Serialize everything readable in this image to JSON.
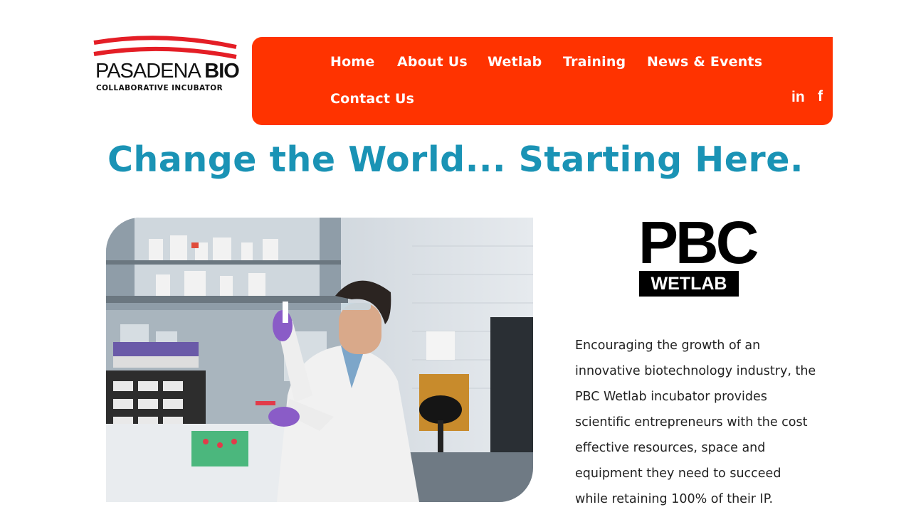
{
  "logo": {
    "name_regular": "PASADENA",
    "name_bold": "BIO",
    "tagline": "COLLABORATIVE INCUBATOR"
  },
  "nav": {
    "items": [
      {
        "label": "Home"
      },
      {
        "label": "About Us"
      },
      {
        "label": "Wetlab"
      },
      {
        "label": "Training"
      },
      {
        "label": "News & Events"
      },
      {
        "label": "Contact Us"
      }
    ],
    "social": {
      "linkedin": "in",
      "facebook": "f"
    }
  },
  "headline": "Change the World... Starting Here.",
  "pbc_logo": {
    "title": "PBC",
    "subtitle": "WETLAB"
  },
  "description": "Encouraging the growth of an innovative biotechnology industry, the PBC Wetlab incubator provides scientific entrepreneurs with the cost effective resources, space and equipment they need to succeed while retaining 100% of their IP.",
  "colors": {
    "accent": "#ff3300",
    "headline": "#1a93b5",
    "logo_red": "#e41e26"
  }
}
